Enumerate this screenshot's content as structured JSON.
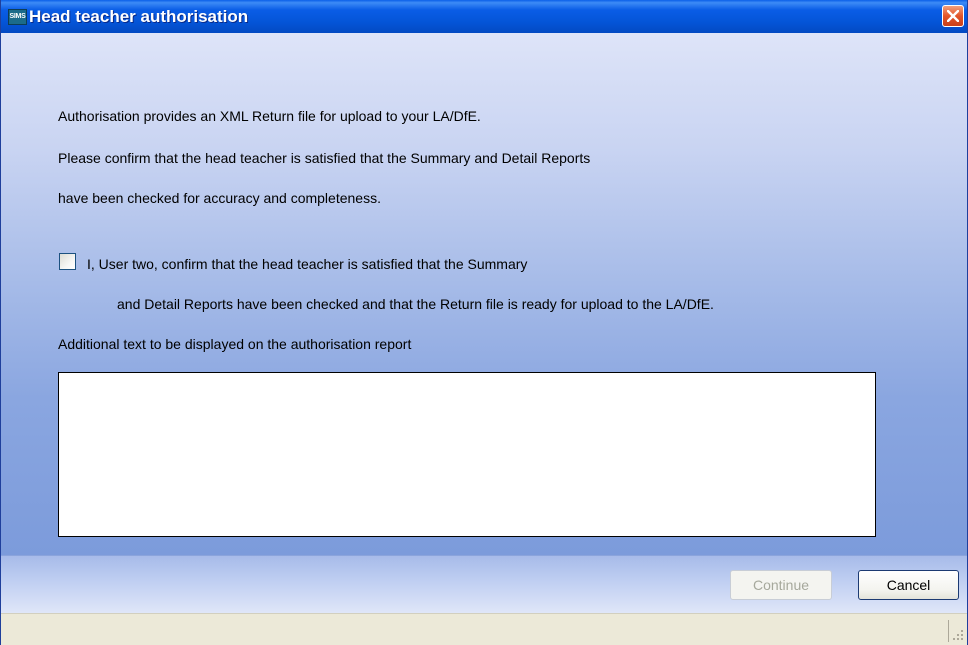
{
  "window": {
    "app_icon_text": "SIMS",
    "title": "Head teacher authorisation",
    "close_icon": "close-icon"
  },
  "content": {
    "intro_line": "Authorisation provides an XML Return file for upload to your LA/DfE.",
    "confirm_line_1": "Please confirm that the head teacher is satisfied that the Summary and Detail Reports",
    "confirm_line_2": "have been checked for accuracy and completeness.",
    "checkbox": {
      "checked": false,
      "label_line_1": "I, User two, confirm that the head teacher is satisfied that the Summary",
      "label_line_2": "and Detail Reports have been checked and that the Return file is ready for upload to the LA/DfE."
    },
    "additional_text_label": "Additional text to be displayed on the authorisation report",
    "additional_text_value": ""
  },
  "buttons": {
    "continue_label": "Continue",
    "continue_enabled": false,
    "cancel_label": "Cancel"
  },
  "colors": {
    "titlebar": "#0454d6",
    "close_button": "#e2552a",
    "client_top": "#dee4f8",
    "client_bottom": "#7c9bdb",
    "disabled_text": "#a6a89c"
  }
}
